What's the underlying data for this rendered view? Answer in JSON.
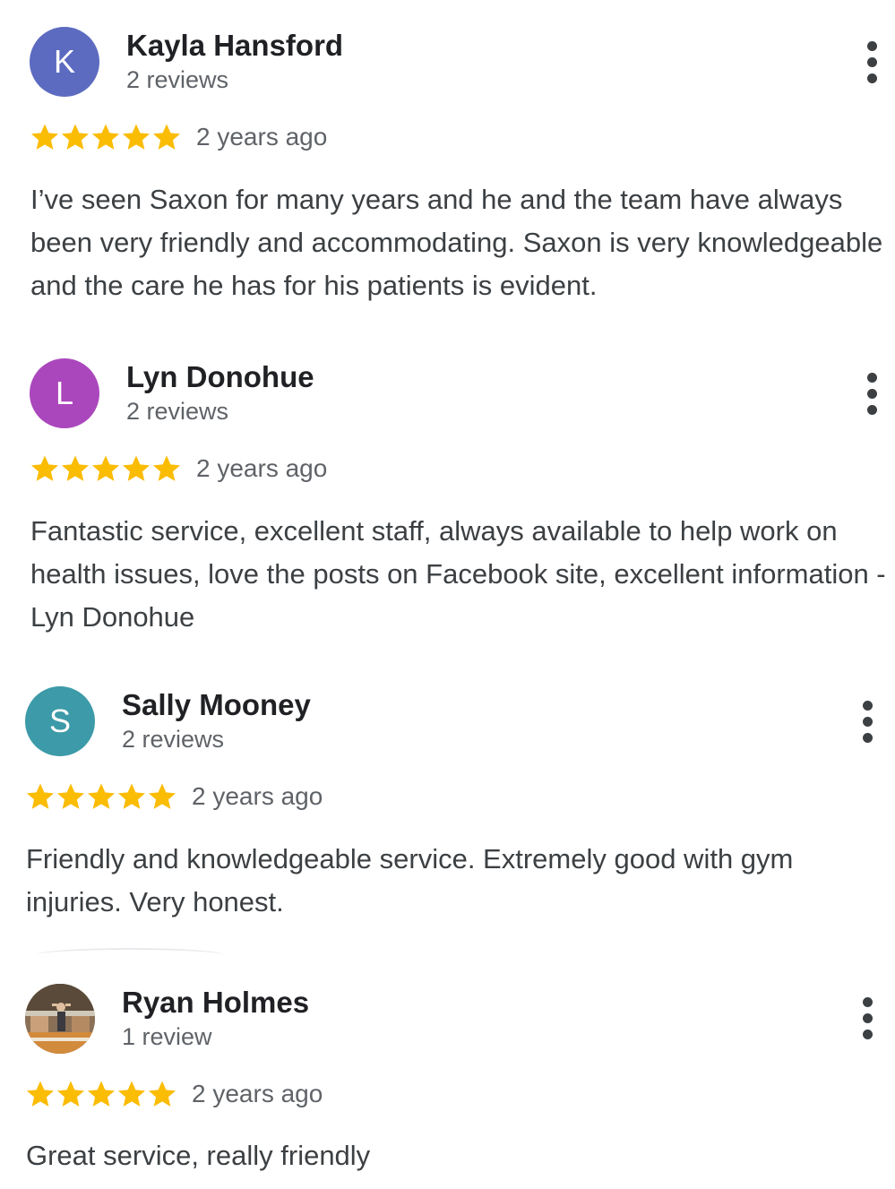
{
  "reviews": [
    {
      "avatar_letter": "K",
      "avatar_color": "#5c6bc0",
      "name": "Kayla Hansford",
      "review_count": "2 reviews",
      "rating": 5,
      "date": "2 years ago",
      "text": "I’ve seen Saxon for many years and he and the team have always been very friendly and accommodating. Saxon is very knowledgeable and the care he has for his patients is evident."
    },
    {
      "avatar_letter": "L",
      "avatar_color": "#ab47bc",
      "name": "Lyn Donohue",
      "review_count": "2 reviews",
      "rating": 5,
      "date": "2 years ago",
      "text": "Fantastic service, excellent staff, always available to help work on health issues, love the posts on Facebook site, excellent information - Lyn Donohue"
    },
    {
      "avatar_letter": "S",
      "avatar_color": "#3d9aa8",
      "name": "Sally Mooney",
      "review_count": "2 reviews",
      "rating": 5,
      "date": "2 years ago",
      "text": "Friendly and knowledgeable service. Extremely good with gym injuries. Very honest."
    },
    {
      "avatar_letter": "",
      "avatar_color": "#6f5a44",
      "name": "Ryan Holmes",
      "review_count": "1 review",
      "rating": 5,
      "date": "2 years ago",
      "text": "Great service, really friendly"
    }
  ],
  "colors": {
    "star": "#fbbc04",
    "name": "#202124",
    "secondary": "#5f6368"
  },
  "icons": {
    "menu": "more-vert-icon",
    "star": "star-icon"
  }
}
